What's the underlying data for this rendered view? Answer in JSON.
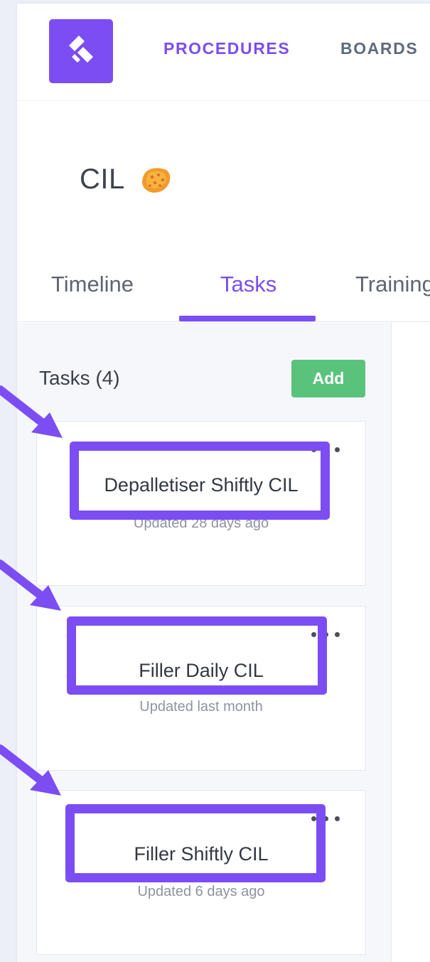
{
  "nav": {
    "procedures": "PROCEDURES",
    "boards": "BOARDS"
  },
  "page": {
    "title": "CIL"
  },
  "tabs": [
    "Timeline",
    "Tasks",
    "Training"
  ],
  "panel": {
    "header": "Tasks (4)",
    "add_label": "Add"
  },
  "tasks": [
    {
      "name": "Depalletiser Shiftly CIL",
      "updated": "Updated 28 days ago"
    },
    {
      "name": "Filler Daily CIL",
      "updated": "Updated last month"
    },
    {
      "name": "Filler Shiftly CIL",
      "updated": "Updated 6 days ago"
    }
  ],
  "colors": {
    "accent": "#7b4df3",
    "add_button": "#5ac37b",
    "background": "#eceef8"
  },
  "icons": {
    "logo": "logo-icon",
    "title": "sponge-icon",
    "menu": "more-dots-icon",
    "annotation": "arrow-icon"
  }
}
